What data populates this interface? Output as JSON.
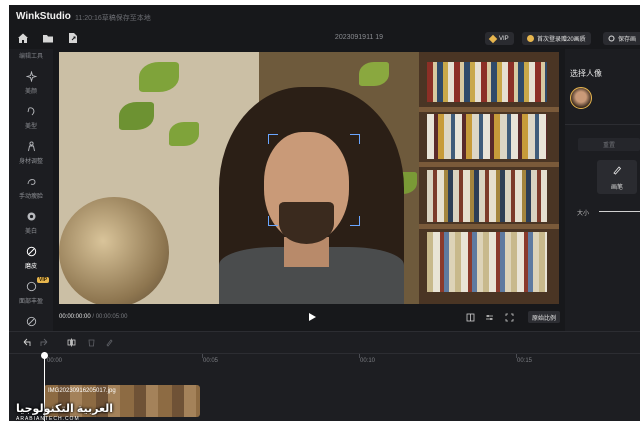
{
  "app": {
    "brand": "WinkStudio",
    "subtitle": "11:20:16草稿保存至本地",
    "doc_title": "2023091911 19"
  },
  "header_buttons": {
    "vip_label": "VIP",
    "promo_label": "首次登录赠20画质",
    "save_label": "保存画"
  },
  "sidebar": {
    "top_label": "编辑工具",
    "items": [
      {
        "label": "美颜",
        "icon": "sparkle-icon"
      },
      {
        "label": "美型",
        "icon": "face-shape-icon"
      },
      {
        "label": "身材调整",
        "icon": "body-icon"
      },
      {
        "label": "手动瘦脸",
        "icon": "hand-slim-icon"
      },
      {
        "label": "美白",
        "icon": "whitening-icon"
      },
      {
        "label": "磨皮",
        "icon": "smooth-skin-icon",
        "active": true
      },
      {
        "label": "面部丰盈",
        "icon": "face-fill-icon",
        "badge": "VIP"
      },
      {
        "label": "",
        "icon": "more-icon"
      }
    ]
  },
  "playback": {
    "current_time": "00:00:00:00",
    "total_time": "/ 00:00:05:00",
    "ratio_label": "原始比例"
  },
  "right_panel": {
    "title": "选择人像",
    "reset_label": "重置",
    "brush_label": "画笔",
    "size_label": "大小"
  },
  "timeline": {
    "ticks": [
      "00:00",
      "00:05",
      "00:10",
      "00:15"
    ],
    "clip_name": "IMG20230916205017.jpg"
  },
  "watermark": {
    "text": "العربية التكنولوجيا",
    "subtext": "ARABIANTECH.COM"
  },
  "colors": {
    "background": "#17181b",
    "panel": "#1c1d21",
    "accent_gold": "#e7b64e",
    "face_box": "#6aa6ff"
  }
}
